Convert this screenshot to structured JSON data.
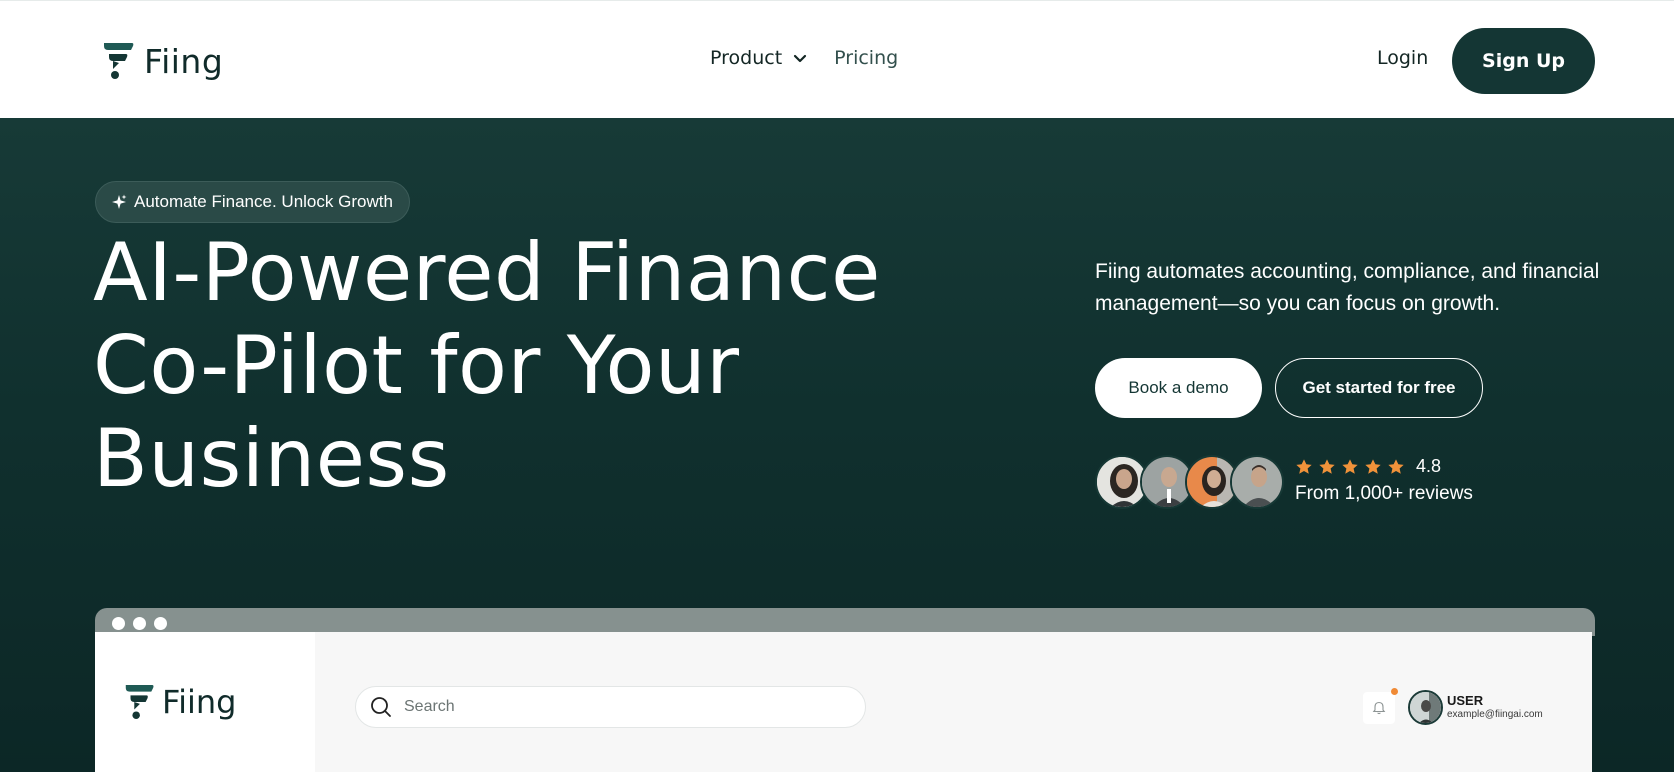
{
  "header": {
    "logo_text": "Fiing",
    "nav": [
      {
        "label": "Product",
        "has_dropdown": true
      },
      {
        "label": "Pricing",
        "has_dropdown": false
      }
    ],
    "login_label": "Login",
    "signup_label": "Sign Up"
  },
  "hero": {
    "badge": "Automate Finance. Unlock Growth",
    "headline": [
      "AI-Powered Finance",
      "Co-Pilot for Your",
      "Business"
    ],
    "description": "Fiing automates accounting, compliance, and financial management—so you can focus on growth.",
    "cta_demo": "Book a demo",
    "cta_free": "Get started for free",
    "rating_value": "4.8",
    "rating_stars": 5,
    "reviews_text": "From 1,000+ reviews"
  },
  "preview": {
    "logo_text": "Fiing",
    "search_placeholder": "Search",
    "user_name": "USER",
    "user_email": "example@fiingai.com"
  },
  "colors": {
    "brand_dark": "#143634",
    "hero_bg": "#10302e",
    "star": "#f0923a",
    "notification_dot": "#f08a35"
  }
}
